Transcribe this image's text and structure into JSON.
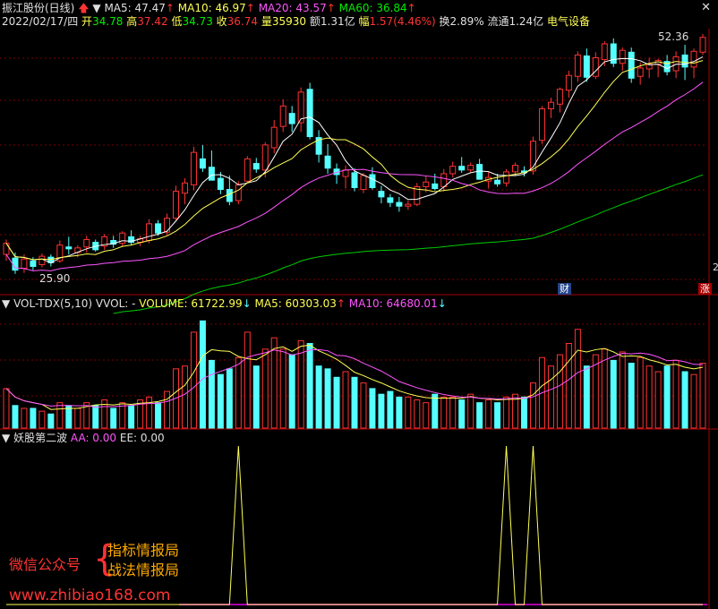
{
  "header": {
    "stock_name": "振江股份(日线)",
    "ma5": "MA5: 47.47",
    "ma10": "MA10: 46.97",
    "ma20": "MA20: 43.57",
    "ma60": "MA60: 36.84",
    "date": "2022/02/17/四",
    "open_label": "开",
    "open": "34.78",
    "high_label": "高",
    "high": "37.42",
    "low_label": "低",
    "low": "34.73",
    "close_label": "收",
    "close": "36.74",
    "volume_label": "量",
    "volume": "35930",
    "amount": "额1.31亿",
    "change_label": "幅",
    "change": "1.57(4.46%)",
    "turnover": "换2.89%",
    "float_cap": "流通1.24亿",
    "sector": "电气设备"
  },
  "price_chart": {
    "max_label": "52.36",
    "min_label": "25.90",
    "badge_cai": "财",
    "badge_zhang": "涨",
    "right_mark": "2"
  },
  "volume_header": {
    "name": "VOL-TDX(5,10)",
    "vvol": "VVOL: -",
    "volume": "VOLUME: 61722.99",
    "ma5": "MA5: 60303.03",
    "ma10": "MA10: 64680.01"
  },
  "indicator_header": {
    "name": "妖股第二波",
    "aa": "AA: 0.00",
    "ee": "EE: 0.00"
  },
  "watermark": {
    "wechat": "微信公众号",
    "line1": "指标情报局",
    "line2": "战法情报局",
    "url": "www.zhibiao168.com"
  },
  "colors": {
    "up": "#ff3333",
    "down": "#55ffff",
    "ma5": "#ffffff",
    "ma10": "#ffff55",
    "ma20": "#ff55ff",
    "ma60": "#00cc00",
    "indicator": "#ffff55",
    "grid": "#7a0000"
  },
  "chart_data": [
    {
      "type": "candlestick",
      "title": "振江股份(日线)",
      "ylim": [
        25.9,
        52.36
      ],
      "ohlc": [
        [
          28.6,
          30.2,
          27.9,
          29.8
        ],
        [
          28.2,
          28.8,
          26.5,
          26.9
        ],
        [
          27.1,
          28.6,
          26.6,
          28.1
        ],
        [
          27.9,
          28.3,
          26.9,
          27.3
        ],
        [
          27.5,
          28.7,
          27.2,
          28.4
        ],
        [
          28.3,
          28.6,
          27.3,
          27.7
        ],
        [
          27.9,
          30.1,
          27.7,
          29.6
        ],
        [
          29.4,
          30.5,
          28.6,
          29.2
        ],
        [
          28.8,
          29.6,
          28.3,
          29.3
        ],
        [
          29.4,
          30.6,
          28.8,
          30.2
        ],
        [
          29.9,
          30.2,
          28.9,
          29.1
        ],
        [
          29.5,
          30.8,
          29.1,
          30.5
        ],
        [
          30.1,
          30.6,
          29.3,
          29.7
        ],
        [
          29.8,
          31.1,
          29.4,
          30.9
        ],
        [
          30.5,
          31.2,
          29.6,
          29.9
        ],
        [
          29.9,
          30.6,
          29.5,
          30.3
        ],
        [
          30.1,
          32.4,
          29.8,
          31.9
        ],
        [
          31.9,
          32.3,
          30.6,
          30.9
        ],
        [
          31.0,
          33.0,
          30.7,
          32.5
        ],
        [
          32.5,
          36.0,
          32.2,
          35.4
        ],
        [
          35.2,
          36.8,
          34.0,
          36.3
        ],
        [
          36.1,
          40.2,
          35.5,
          39.6
        ],
        [
          38.9,
          40.4,
          37.5,
          37.9
        ],
        [
          38.0,
          39.8,
          36.7,
          36.6
        ],
        [
          36.8,
          37.5,
          35.1,
          35.6
        ],
        [
          35.6,
          37.1,
          33.9,
          34.3
        ],
        [
          34.4,
          36.5,
          34.0,
          36.1
        ],
        [
          36.5,
          39.2,
          36.3,
          38.9
        ],
        [
          38.4,
          39.0,
          37.4,
          37.8
        ],
        [
          37.7,
          40.7,
          36.9,
          40.4
        ],
        [
          40.1,
          43.1,
          39.5,
          42.3
        ],
        [
          42.4,
          45.3,
          41.8,
          44.6
        ],
        [
          43.8,
          44.6,
          41.8,
          42.7
        ],
        [
          42.8,
          46.6,
          41.8,
          46.1
        ],
        [
          46.4,
          47.1,
          41.0,
          41.3
        ],
        [
          41.2,
          42.0,
          38.5,
          39.4
        ],
        [
          39.2,
          40.5,
          37.3,
          37.9
        ],
        [
          37.8,
          38.4,
          36.2,
          37.2
        ],
        [
          37.0,
          38.2,
          35.7,
          37.7
        ],
        [
          37.4,
          37.9,
          35.4,
          35.8
        ],
        [
          35.6,
          37.4,
          35.2,
          37.1
        ],
        [
          37.2,
          38.0,
          35.6,
          35.8
        ],
        [
          35.4,
          36.0,
          34.1,
          34.8
        ],
        [
          34.7,
          35.1,
          33.7,
          34.2
        ],
        [
          34.2,
          34.8,
          33.2,
          33.8
        ],
        [
          33.8,
          34.4,
          33.4,
          34.0
        ],
        [
          34.0,
          36.3,
          33.8,
          35.9
        ],
        [
          35.9,
          37.1,
          35.3,
          36.4
        ],
        [
          36.2,
          37.3,
          35.5,
          35.7
        ],
        [
          35.9,
          37.8,
          35.4,
          37.3
        ],
        [
          37.3,
          38.6,
          36.9,
          38.1
        ],
        [
          38.1,
          39.1,
          37.4,
          37.7
        ],
        [
          37.7,
          38.5,
          37.4,
          38.2
        ],
        [
          38.3,
          38.9,
          36.8,
          36.7
        ],
        [
          36.5,
          37.5,
          35.7,
          36.9
        ],
        [
          36.6,
          37.3,
          35.9,
          36.2
        ],
        [
          36.3,
          37.8,
          35.9,
          37.5
        ],
        [
          37.5,
          38.5,
          37.0,
          38.2
        ],
        [
          37.6,
          38.1,
          37.0,
          37.4
        ],
        [
          37.6,
          41.3,
          37.2,
          40.8
        ],
        [
          40.9,
          44.6,
          40.5,
          44.3
        ],
        [
          44.3,
          45.5,
          43.3,
          45.0
        ],
        [
          44.8,
          46.6,
          43.9,
          46.4
        ],
        [
          46.3,
          48.4,
          45.5,
          47.9
        ],
        [
          47.8,
          50.5,
          47.2,
          50.1
        ],
        [
          50.0,
          50.8,
          47.2,
          47.7
        ],
        [
          47.8,
          50.4,
          47.5,
          49.8
        ],
        [
          49.6,
          51.6,
          48.9,
          51.3
        ],
        [
          51.3,
          51.9,
          48.8,
          49.2
        ],
        [
          49.2,
          50.9,
          48.4,
          50.6
        ],
        [
          50.4,
          50.9,
          47.1,
          47.6
        ],
        [
          47.8,
          49.3,
          46.9,
          48.7
        ],
        [
          48.6,
          49.8,
          47.6,
          49.1
        ],
        [
          49.1,
          49.7,
          47.7,
          49.5
        ],
        [
          49.4,
          50.1,
          47.9,
          48.3
        ],
        [
          48.4,
          50.5,
          47.6,
          49.9
        ],
        [
          50.1,
          51.2,
          47.4,
          48.8
        ],
        [
          48.8,
          50.8,
          47.6,
          50.5
        ],
        [
          50.4,
          52.36,
          50.1,
          52.0
        ]
      ],
      "ma_labels": [
        "MA5",
        "MA10",
        "MA20",
        "MA60"
      ]
    },
    {
      "type": "bar",
      "title": "VOL-TDX(5,10)",
      "values": [
        14,
        8,
        7,
        7,
        6,
        5,
        9,
        8,
        7,
        9,
        8,
        10,
        7,
        9,
        8,
        10,
        11,
        9,
        13,
        21,
        22,
        34,
        38,
        24,
        19,
        21,
        25,
        34,
        22,
        28,
        32,
        28,
        26,
        31,
        30,
        22,
        21,
        18,
        20,
        18,
        16,
        14,
        12,
        13,
        11,
        11,
        10,
        9,
        12,
        11,
        11,
        10,
        12,
        9,
        10,
        9,
        11,
        12,
        11,
        16,
        25,
        22,
        26,
        30,
        35,
        22,
        26,
        28,
        24,
        27,
        23,
        25,
        22,
        20,
        22,
        24,
        20,
        19,
        23
      ],
      "ylim": [
        0,
        40
      ]
    },
    {
      "type": "line",
      "title": "妖股第二波",
      "series": [
        {
          "name": "AA",
          "values": [
            0,
            0,
            0,
            0,
            0,
            0,
            0,
            0,
            0,
            0,
            0,
            0,
            0,
            0,
            0,
            0,
            0,
            0,
            0,
            0,
            0,
            0,
            0,
            0,
            0,
            0,
            1,
            0,
            0,
            0,
            0,
            0,
            0,
            0,
            0,
            0,
            0,
            0,
            0,
            0,
            0,
            0,
            0,
            0,
            0,
            0,
            0,
            0,
            0,
            0,
            0,
            0,
            0,
            0,
            0,
            0,
            1,
            0,
            0,
            1,
            0,
            0,
            0,
            0,
            0,
            0,
            0,
            0,
            0,
            0,
            0,
            0,
            0,
            0,
            0,
            0,
            0,
            0,
            0
          ]
        }
      ],
      "ylim": [
        0,
        1
      ]
    }
  ]
}
